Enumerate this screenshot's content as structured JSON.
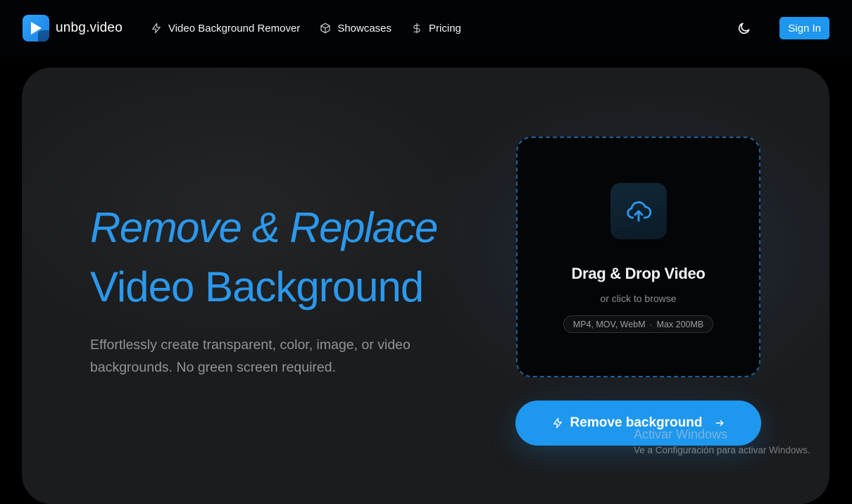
{
  "brand": {
    "name": "unbg.video",
    "logo_icon": "play-logo-icon",
    "accent": "#1e97ef"
  },
  "nav": {
    "items": [
      {
        "label": "Video Background Remover",
        "icon": "lightning-icon"
      },
      {
        "label": "Showcases",
        "icon": "cube-icon"
      },
      {
        "label": "Pricing",
        "icon": "dollar-icon"
      }
    ],
    "theme_icon": "moon-icon",
    "signin_label": "Sign In"
  },
  "hero": {
    "headline_line1": "Remove & Replace",
    "headline_line2": "Video Background",
    "subtitle": "Effortlessly create transparent, color, image, or video backgrounds. No green screen required."
  },
  "upload": {
    "icon": "cloud-upload-icon",
    "title": "Drag & Drop Video",
    "hint": "or click to browse",
    "formats": "MP4, MOV, WebM",
    "separator": "·",
    "max_size": "Max 200MB"
  },
  "cta": {
    "label": "Remove background",
    "icon": "lightning-icon",
    "arrow_icon": "arrow-right-icon"
  },
  "watermark": {
    "title": "Activar Windows",
    "subtitle": "Ve a Configuración para activar Windows."
  }
}
